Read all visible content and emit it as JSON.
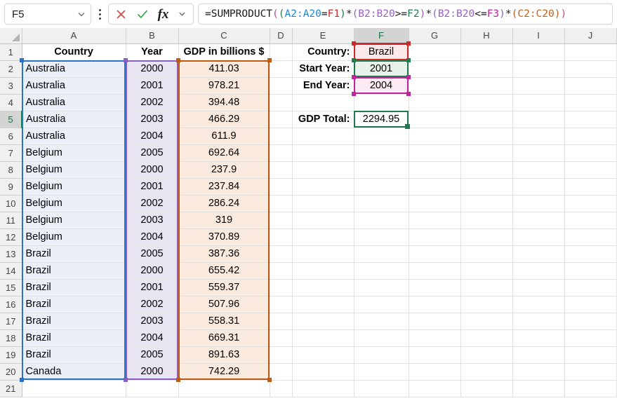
{
  "app": "spreadsheet",
  "formula_bar": {
    "name_box_value": "F5",
    "name_box_dropdown_icon": "chevron-down-icon",
    "menu_icon": "kebab-menu-icon",
    "cancel_icon": "cancel-x-icon",
    "confirm_icon": "confirm-check-icon",
    "function_icon": "fx-icon",
    "function_dropdown_icon": "chevron-down-icon",
    "formula_plain": "=SUMPRODUCT((A2:A20=F1)*(B2:B20>=F2)*(B2:B20<=F3)*(C2:C20))",
    "formula_tokens": [
      {
        "t": "=SUMPRODUCT",
        "c": "#1a1a1a"
      },
      {
        "t": "(",
        "c": "#c04a8f"
      },
      {
        "t": "(",
        "c": "#1f7a4d"
      },
      {
        "t": "A2:A20",
        "c": "#1f86d6"
      },
      {
        "t": "=",
        "c": "#1a1a1a"
      },
      {
        "t": "F1",
        "c": "#cc2b2b"
      },
      {
        "t": ")",
        "c": "#1f7a4d"
      },
      {
        "t": "*",
        "c": "#1a1a1a"
      },
      {
        "t": "(",
        "c": "#9a5fc7"
      },
      {
        "t": "B2:B20",
        "c": "#9a5fc7"
      },
      {
        "t": ">=",
        "c": "#1a1a1a"
      },
      {
        "t": "F2",
        "c": "#1f7a4d"
      },
      {
        "t": ")",
        "c": "#9a5fc7"
      },
      {
        "t": "*",
        "c": "#1a1a1a"
      },
      {
        "t": "(",
        "c": "#9a5fc7"
      },
      {
        "t": "B2:B20",
        "c": "#9a5fc7"
      },
      {
        "t": "<=",
        "c": "#1a1a1a"
      },
      {
        "t": "F3",
        "c": "#c0249a"
      },
      {
        "t": ")",
        "c": "#9a5fc7"
      },
      {
        "t": "*",
        "c": "#1a1a1a"
      },
      {
        "t": "(",
        "c": "#c4601a"
      },
      {
        "t": "C2:C20",
        "c": "#c4601a"
      },
      {
        "t": ")",
        "c": "#c4601a"
      },
      {
        "t": ")",
        "c": "#c04a8f"
      }
    ]
  },
  "sheet": {
    "column_headers": [
      "A",
      "B",
      "C",
      "D",
      "E",
      "F",
      "G",
      "H",
      "I",
      "J"
    ],
    "active_column": "F",
    "active_row": 5,
    "row_headers": [
      1,
      2,
      3,
      4,
      5,
      6,
      7,
      8,
      9,
      10,
      11,
      12,
      13,
      14,
      15,
      16,
      17,
      18,
      19,
      20,
      21
    ],
    "table_headers": {
      "a": "Country",
      "b": "Year",
      "c": "GDP in billions $"
    },
    "rows": [
      {
        "r": 2,
        "country": "Australia",
        "year": "2000",
        "gdp": "411.03"
      },
      {
        "r": 3,
        "country": "Australia",
        "year": "2001",
        "gdp": "978.21"
      },
      {
        "r": 4,
        "country": "Australia",
        "year": "2002",
        "gdp": "394.48"
      },
      {
        "r": 5,
        "country": "Australia",
        "year": "2003",
        "gdp": "466.29"
      },
      {
        "r": 6,
        "country": "Australia",
        "year": "2004",
        "gdp": "611.9"
      },
      {
        "r": 7,
        "country": "Belgium",
        "year": "2005",
        "gdp": "692.64"
      },
      {
        "r": 8,
        "country": "Belgium",
        "year": "2000",
        "gdp": "237.9"
      },
      {
        "r": 9,
        "country": "Belgium",
        "year": "2001",
        "gdp": "237.84"
      },
      {
        "r": 10,
        "country": "Belgium",
        "year": "2002",
        "gdp": "286.24"
      },
      {
        "r": 11,
        "country": "Belgium",
        "year": "2003",
        "gdp": "319"
      },
      {
        "r": 12,
        "country": "Belgium",
        "year": "2004",
        "gdp": "370.89"
      },
      {
        "r": 13,
        "country": "Brazil",
        "year": "2005",
        "gdp": "387.36"
      },
      {
        "r": 14,
        "country": "Brazil",
        "year": "2000",
        "gdp": "655.42"
      },
      {
        "r": 15,
        "country": "Brazil",
        "year": "2001",
        "gdp": "559.37"
      },
      {
        "r": 16,
        "country": "Brazil",
        "year": "2002",
        "gdp": "507.96"
      },
      {
        "r": 17,
        "country": "Brazil",
        "year": "2003",
        "gdp": "558.31"
      },
      {
        "r": 18,
        "country": "Brazil",
        "year": "2004",
        "gdp": "669.31"
      },
      {
        "r": 19,
        "country": "Brazil",
        "year": "2005",
        "gdp": "891.63"
      },
      {
        "r": 20,
        "country": "Canada",
        "year": "2000",
        "gdp": "742.29"
      }
    ],
    "criteria": {
      "country_label": "Country:",
      "country_value": "Brazil",
      "start_year_label": "Start Year:",
      "start_year_value": "2001",
      "end_year_label": "End Year:",
      "end_year_value": "2004",
      "total_label": "GDP Total:",
      "total_value": "2294.95"
    }
  },
  "colors": {
    "range_a": "#2a72c4",
    "range_b": "#8b5fc0",
    "range_c": "#bf5a12",
    "ref_f1": "#cc2b2b",
    "ref_f2": "#1f7a4d",
    "ref_f3": "#c0249a",
    "selection": "#1f7a4d",
    "fill_a": "#eaeff8",
    "fill_b": "#e9e4f2",
    "fill_c": "#fbeade",
    "fill_f1": "#fbe8e8",
    "fill_f2": "#e9f2ea",
    "fill_f3": "#fbe9f3"
  }
}
